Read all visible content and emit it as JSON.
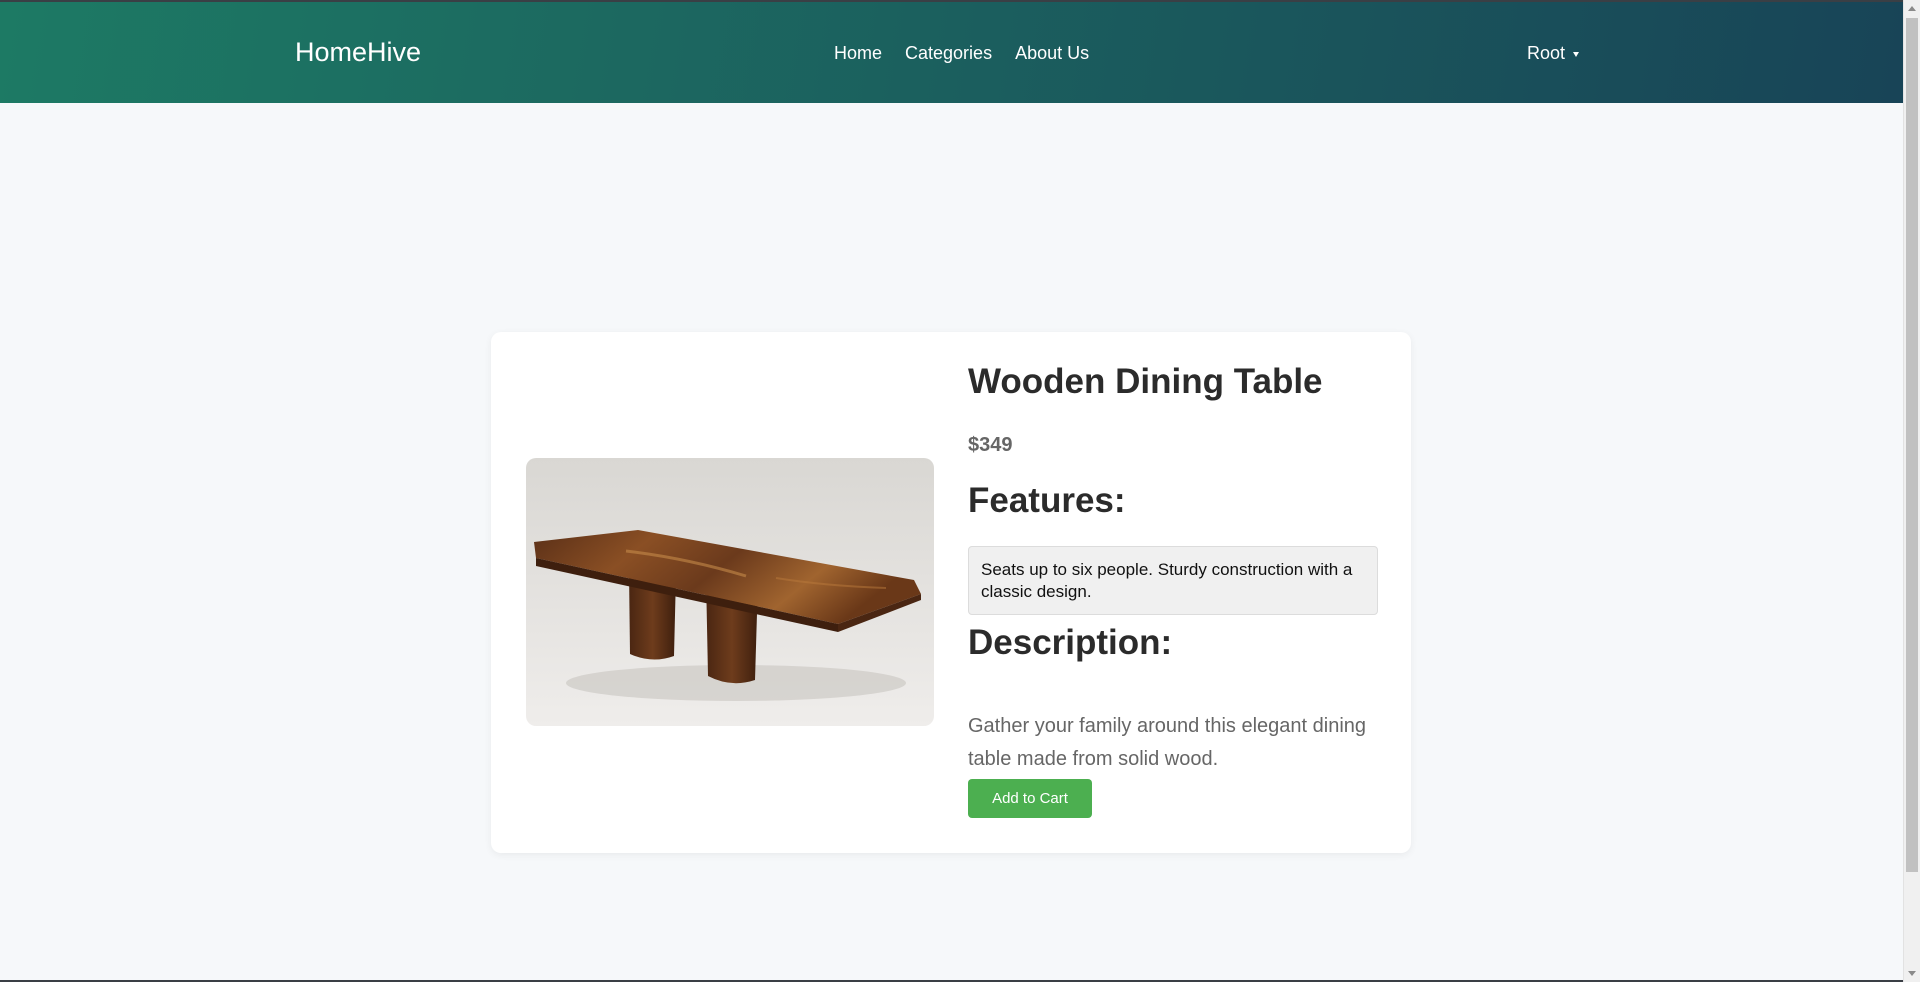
{
  "header": {
    "brand": "HomeHive",
    "nav": [
      {
        "label": "Home"
      },
      {
        "label": "Categories"
      },
      {
        "label": "About Us"
      }
    ],
    "user": {
      "label": "Root",
      "icon": "caret-down-icon"
    }
  },
  "product": {
    "title": "Wooden Dining Table",
    "price": "$349",
    "features_heading": "Features:",
    "features_text": "Seats up to six people. Sturdy construction with a classic design.",
    "description_heading": "Description:",
    "description_text": "Gather your family around this elegant dining table made from solid wood.",
    "add_to_cart_label": "Add to Cart",
    "image": "wooden-dining-table-photo"
  },
  "colors": {
    "header_start": "#1d7a64",
    "header_end": "#184457",
    "button": "#4caf50",
    "background": "#f6f8fa"
  }
}
